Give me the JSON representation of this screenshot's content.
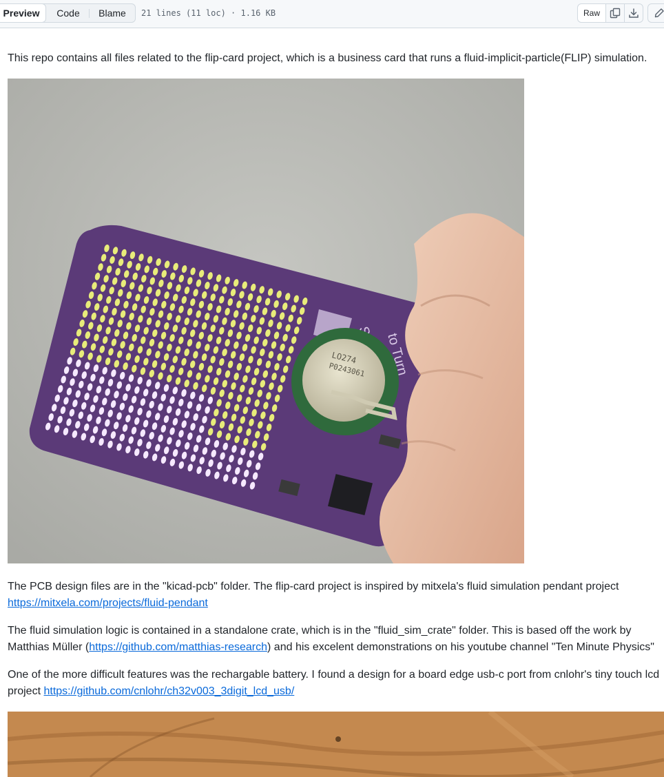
{
  "toolbar": {
    "tabs": [
      {
        "label": "Preview",
        "active": true
      },
      {
        "label": "Code",
        "active": false
      },
      {
        "label": "Blame",
        "active": false
      }
    ],
    "file_meta": "21 lines (11 loc) · 1.16 KB",
    "raw_label": "Raw",
    "copy_icon": "copy-icon",
    "download_icon": "download-icon",
    "edit_icon": "pencil-icon"
  },
  "readme": {
    "intro": "This repo contains all files related to the flip-card project, which is a business card that runs a fluid-implicit-particle(FLIP) simulation.",
    "pcb_text": "The PCB design files are in the \"kicad-pcb\" folder. The flip-card project is inspired by mitxela's fluid simulation pendant project",
    "pcb_link": "https://mitxela.com/projects/fluid-pendant",
    "sim_text_a": "The fluid simulation logic is contained in a standalone crate, which is in the \"fluid_sim_crate\" folder. This is based off the work by Matthias Müller (",
    "sim_link": "https://github.com/matthias-research",
    "sim_text_b": ") and his excelent demonstrations on his youtube channel \"Ten Minute Physics\"",
    "battery_text": "One of the more difficult features was the rechargable battery. I found a design for a board edge usb-c port from cnlohr's tiny touch lcd project",
    "battery_link": "https://github.com/cnlohr/ch32v003_3digit_lcd_usb/",
    "card_silkscreen_line1": "Shake",
    "card_silkscreen_line2": "to Turn",
    "card_silkscreen_line3": "On",
    "battery_marking_line1": "LO274",
    "battery_marking_line2": "P0243061"
  },
  "colors": {
    "link": "#0969da",
    "pcb_purple": "#5b3a78",
    "led_yellow": "#e8ec7a",
    "led_white": "#f6e9ff",
    "battery_green": "#2f6a3c"
  }
}
